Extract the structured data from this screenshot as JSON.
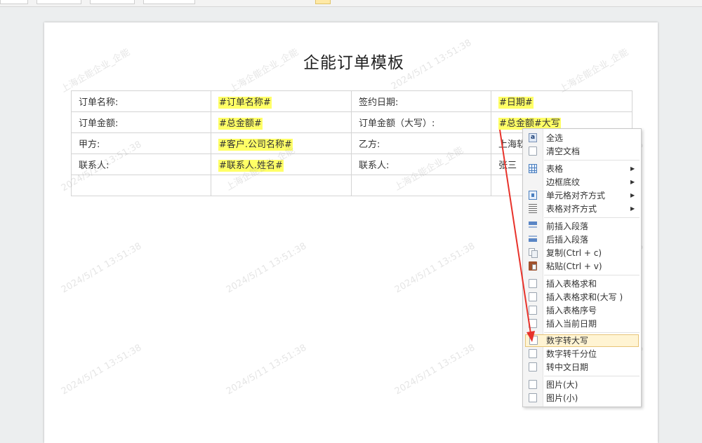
{
  "document": {
    "title": "企能订单模板",
    "table": [
      [
        "订单名称:",
        "#订单名称#",
        "签约日期:",
        "#日期#"
      ],
      [
        "订单金额:",
        "#总金额#",
        "订单金额（大写）:",
        "#总金额#大写"
      ],
      [
        "甲方:",
        "#客户.公司名称#",
        "乙方:",
        "上海软"
      ],
      [
        "联系人:",
        "#联系人.姓名#",
        "联系人:",
        "张三"
      ],
      [
        "",
        "",
        "",
        ""
      ]
    ],
    "watermark_company": "上海企能企业_企能",
    "watermark_time": "2024/5/11 13:51:38"
  },
  "context_menu": {
    "select_all": "全选",
    "clear_document": "清空文档",
    "table": "表格",
    "border_shading": "边框底纹",
    "cell_alignment": "单元格对齐方式",
    "table_alignment": "表格对齐方式",
    "insert_paragraph_before": "前插入段落",
    "insert_paragraph_after": "后插入段落",
    "copy": "复制(Ctrl + c)",
    "paste": "粘贴(Ctrl + v)",
    "insert_table_sum": "插入表格求和",
    "insert_table_sum_upper": "插入表格求和(大写 )",
    "insert_table_index": "插入表格序号",
    "insert_current_date": "插入当前日期",
    "number_to_upper": "数字转大写",
    "number_to_thousands": "数字转千分位",
    "to_chinese_date": "转中文日期",
    "image_large": "图片(大)",
    "image_small": "图片(小)"
  },
  "colors": {
    "placeholder_highlight": "#ffff66",
    "menu_active_bg": "#fff4d3",
    "annotation_arrow": "#e8322a"
  }
}
